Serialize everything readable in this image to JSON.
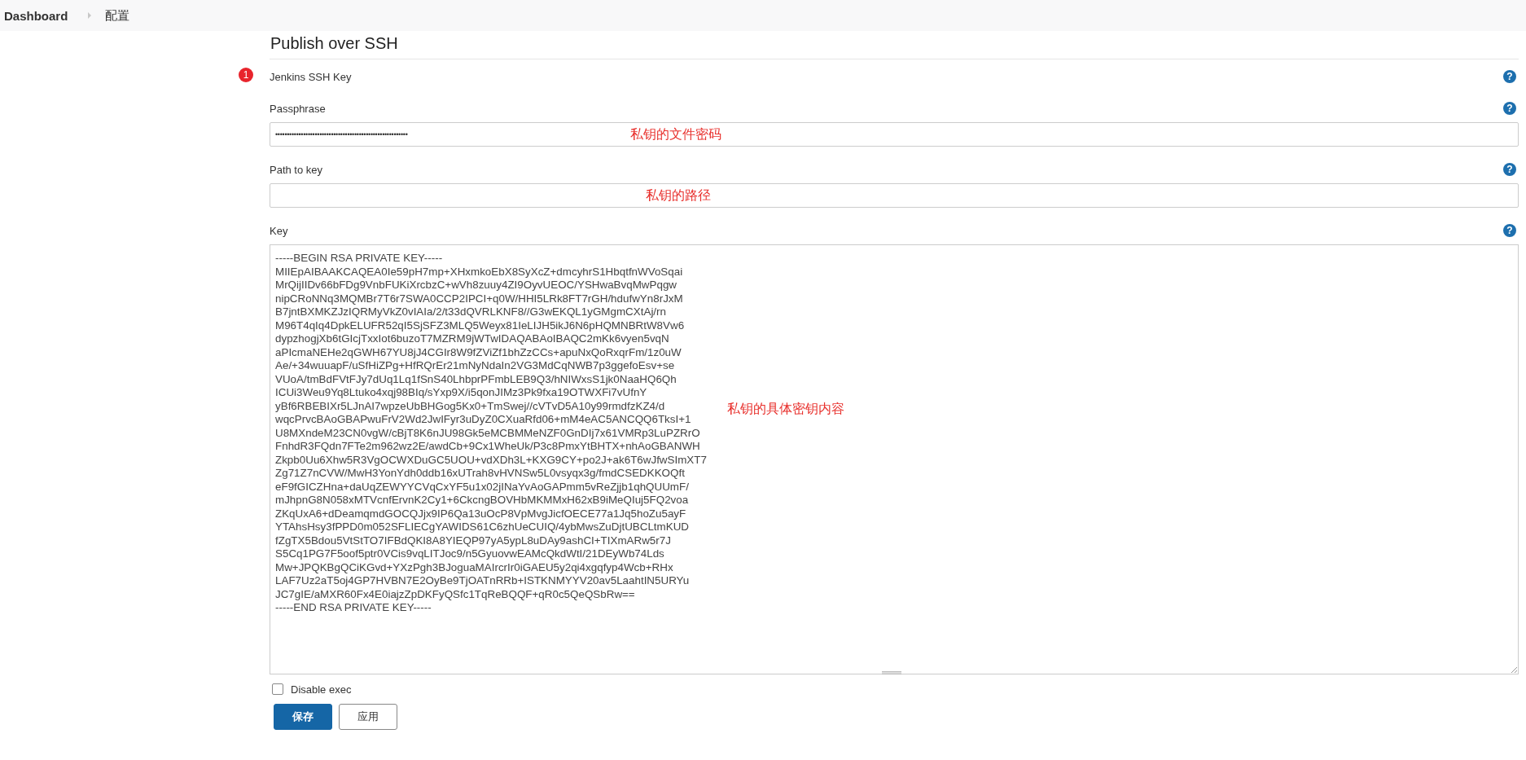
{
  "breadcrumb": [
    {
      "label": "Dashboard",
      "current": false
    },
    {
      "label": "配置",
      "current": true
    }
  ],
  "section": {
    "title": "Publish over SSH",
    "error_badge": "1",
    "help_glyph": "?"
  },
  "fields": [
    {
      "kind": "label",
      "label": "Jenkins SSH Key"
    },
    {
      "kind": "password",
      "label": "Passphrase",
      "value": "•••••••••••••••••••••••••••••••••••••••••••••••••••••••••",
      "annotation": "私钥的文件密码"
    },
    {
      "kind": "text",
      "label": "Path to key",
      "annotation": "私钥的路径"
    },
    {
      "kind": "textarea",
      "label": "Key",
      "annotation": "私钥的具体密钥内容",
      "value": "-----BEGIN RSA PRIVATE KEY-----\nMIIEpAIBAAKCAQEA0Ie59pH7mp+XHxmkoEbX8SyXcZ+dmcyhrS1HbqtfnWVoSqai\nMrQijIIDv66bFDg9VnbFUKiXrcbzC+wVh8zuuy4ZI9OyvUEOC/YSHwaBvqMwPqgw\nnipCRoNNq3MQMBr7T6r7SWA0CCP2IPCI+q0W/HHI5LRk8FT7rGH/hdufwYn8rJxM\nB7jntBXMKZJzIQRMyVkZ0vIAIa/2/t33dQVRLKNF8//G3wEKQL1yGMgmCXtAj/rn\nM96T4qIq4DpkELUFR52qI5SjSFZ3MLQ5Weyx81IeLIJH5ikJ6N6pHQMNBRtW8Vw6\ndypzhogjXb6tGIcjTxxIot6buzoT7MZRM9jWTwIDAQABAoIBAQC2mKk6vyen5vqN\naPIcmaNEHe2qGWH67YU8jJ4CGIr8W9fZViZf1bhZzCCs+apuNxQoRxqrFm/1z0uW\nAe/+34wuuapF/uSfHiZPg+HfRQrEr21mNyNdaIn2VG3MdCqNWB7p3ggefoEsv+se\nVUoA/tmBdFVtFJy7dUq1Lq1fSnS40LhbprPFmbLEB9Q3/hNIWxsS1jk0NaaHQ6Qh\nICUi3Weu9Yq8Ltuko4xqj98BIq/sYxp9X/i5qonJIMz3Pk9fxa19OTWXFi7vUfnY\nyBf6RBEBIXr5LJnAI7wpzeUbBHGog5Kx0+TmSwej//cVTvD5A10y99rmdfzKZ4/d\nwqcPrvcBAoGBAPwuFrV2Wd2JwIFyr3uDyZ0CXuaRfd06+mM4eAC5ANCQQ6TksI+1\nU8MXndeM23CN0vgW/cBjT8K6nJU98Gk5eMCBMMeNZF0GnDIj7x61VMRp3LuPZRrO\nFnhdR3FQdn7FTe2m962wz2E/awdCb+9Cx1WheUk/P3c8PmxYtBHTX+nhAoGBANWH\nZkpb0Uu6Xhw5R3VgOCWXDuGC5UOU+vdXDh3L+KXG9CY+po2J+ak6T6wJfwSImXT7\nZg71Z7nCVW/MwH3YonYdh0ddb16xUTrah8vHVNSw5L0vsyqx3g/fmdCSEDKKOQft\neF9fGICZHna+daUqZEWYYCVqCxYF5u1x02jINaYvAoGAPmm5vReZjjb1qhQUUmF/\nmJhpnG8N058xMTVcnfErvnK2Cy1+6CkcngBOVHbMKMMxH62xB9iMeQIuj5FQ2voa\nZKqUxA6+dDeamqmdGOCQJjx9IP6Qa13uOcP8VpMvgJicfOECE77a1Jq5hoZu5ayF\nYTAhsHsy3fPPD0m052SFLIECgYAWIDS61C6zhUeCUIQ/4ybMwsZuDjtUBCLtmKUD\nfZgTX5Bdou5VtStTO7IFBdQKI8A8YIEQP97yA5ypL8uDAy9ashCI+TIXmARw5r7J\nS5Cq1PG7F5oof5ptr0VCis9vqLITJoc9/n5GyuovwEAMcQkdWtI/21DEyWb74Lds\nMw+JPQKBgQCiKGvd+YXzPgh3BJoguaMAIrcrIr0iGAEU5y2qi4xgqfyp4Wcb+RHx\nLAF7Uz2aT5oj4GP7HVBN7E2OyBe9TjOATnRRb+ISTKNMYYV20av5LaahtIN5URYu\nJC7gIE/aMXR60Fx4E0iajzZpDKFyQSfc1TqReBQQF+qR0c5QeQSbRw==\n-----END RSA PRIVATE KEY-----"
    },
    {
      "kind": "checkbox",
      "label": "Disable exec",
      "checked": false
    }
  ],
  "buttons": [
    {
      "label": "保存",
      "primary": true
    },
    {
      "label": "应用",
      "primary": false
    }
  ]
}
